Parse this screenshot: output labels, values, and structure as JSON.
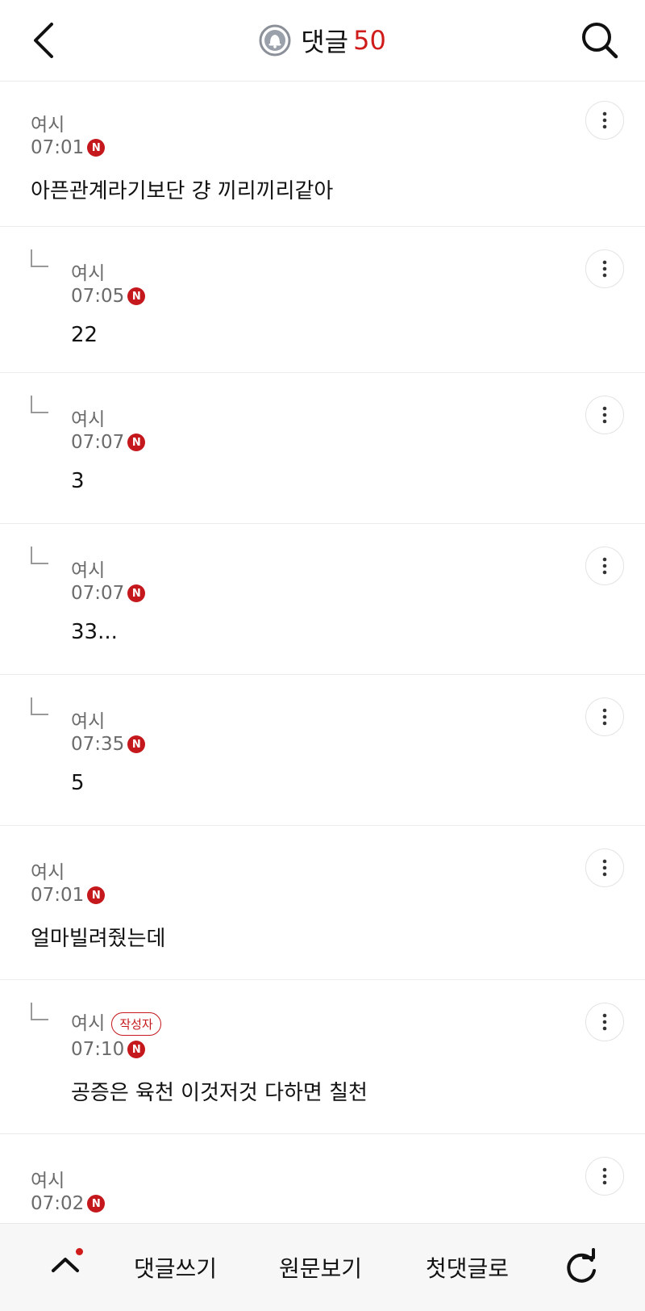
{
  "header": {
    "title": "댓글",
    "count": "50",
    "back_icon": "chevron-left-icon",
    "search_icon": "search-icon",
    "bell_icon": "bell-icon"
  },
  "comments": [
    {
      "author": "여시",
      "time": "07:01",
      "badge": "N",
      "text": "아픈관계라기보단 걍 끼리끼리같아",
      "reply": false
    },
    {
      "author": "여시",
      "time": "07:05",
      "badge": "N",
      "text": "22",
      "reply": true
    },
    {
      "author": "여시",
      "time": "07:07",
      "badge": "N",
      "text": "3",
      "reply": true
    },
    {
      "author": "여시",
      "time": "07:07",
      "badge": "N",
      "text": "33...",
      "reply": true
    },
    {
      "author": "여시",
      "time": "07:35",
      "badge": "N",
      "text": "5",
      "reply": true
    },
    {
      "author": "여시",
      "time": "07:01",
      "badge": "N",
      "text": "얼마빌려줬는데",
      "reply": false
    },
    {
      "author": "여시",
      "author_badge": "작성자",
      "time": "07:10",
      "badge": "N",
      "text": "공증은 육천 이것저것 다하면 칠천",
      "reply": true
    },
    {
      "author": "여시",
      "time": "07:02",
      "badge": "N",
      "text": "",
      "reply": false
    }
  ],
  "bottom_bar": {
    "write": "댓글쓰기",
    "original": "원문보기",
    "first": "첫댓글로"
  },
  "colors": {
    "accent": "#d01b1b",
    "badge": "#c4181c",
    "muted": "#6b6b6b"
  }
}
